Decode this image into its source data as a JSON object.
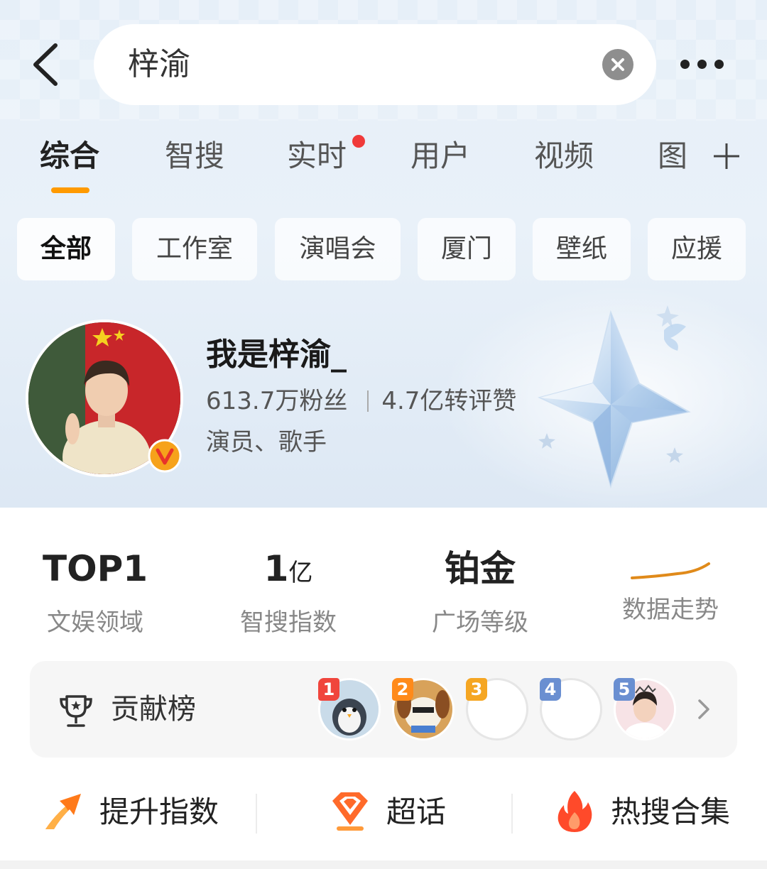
{
  "search": {
    "query": "梓渝"
  },
  "tabs": [
    {
      "label": "综合",
      "active": true
    },
    {
      "label": "智搜"
    },
    {
      "label": "实时",
      "has_dot": true
    },
    {
      "label": "用户"
    },
    {
      "label": "视频"
    },
    {
      "label": "图"
    }
  ],
  "chips": [
    "全部",
    "工作室",
    "演唱会",
    "厦门",
    "壁纸",
    "应援"
  ],
  "profile": {
    "name": "我是梓渝_",
    "fans": "613.7万粉丝",
    "interactions": "4.7亿转评赞",
    "tags": "演员、歌手"
  },
  "metrics": [
    {
      "value": "TOP1",
      "unit": "",
      "label": "文娱领域"
    },
    {
      "value": "1",
      "unit": "亿",
      "label": "智搜指数"
    },
    {
      "value": "铂金",
      "unit": "",
      "label": "广场等级"
    },
    {
      "value": "",
      "unit": "",
      "label": "数据走势"
    }
  ],
  "contribution": {
    "label": "贡献榜",
    "ranks": [
      "1",
      "2",
      "3",
      "4",
      "5"
    ]
  },
  "actions": [
    {
      "label": "提升指数",
      "icon": "boost-arrow-icon"
    },
    {
      "label": "超话",
      "icon": "super-topic-diamond-icon"
    },
    {
      "label": "热搜合集",
      "icon": "flame-icon"
    }
  ],
  "colors": {
    "accent": "#ff9a00",
    "red_dot": "#f03a3a",
    "rank_red": "#f0453c",
    "rank_orange": "#ff8a1a",
    "rank_yellow": "#f5a623",
    "rank_blue": "#6a8fd1"
  }
}
